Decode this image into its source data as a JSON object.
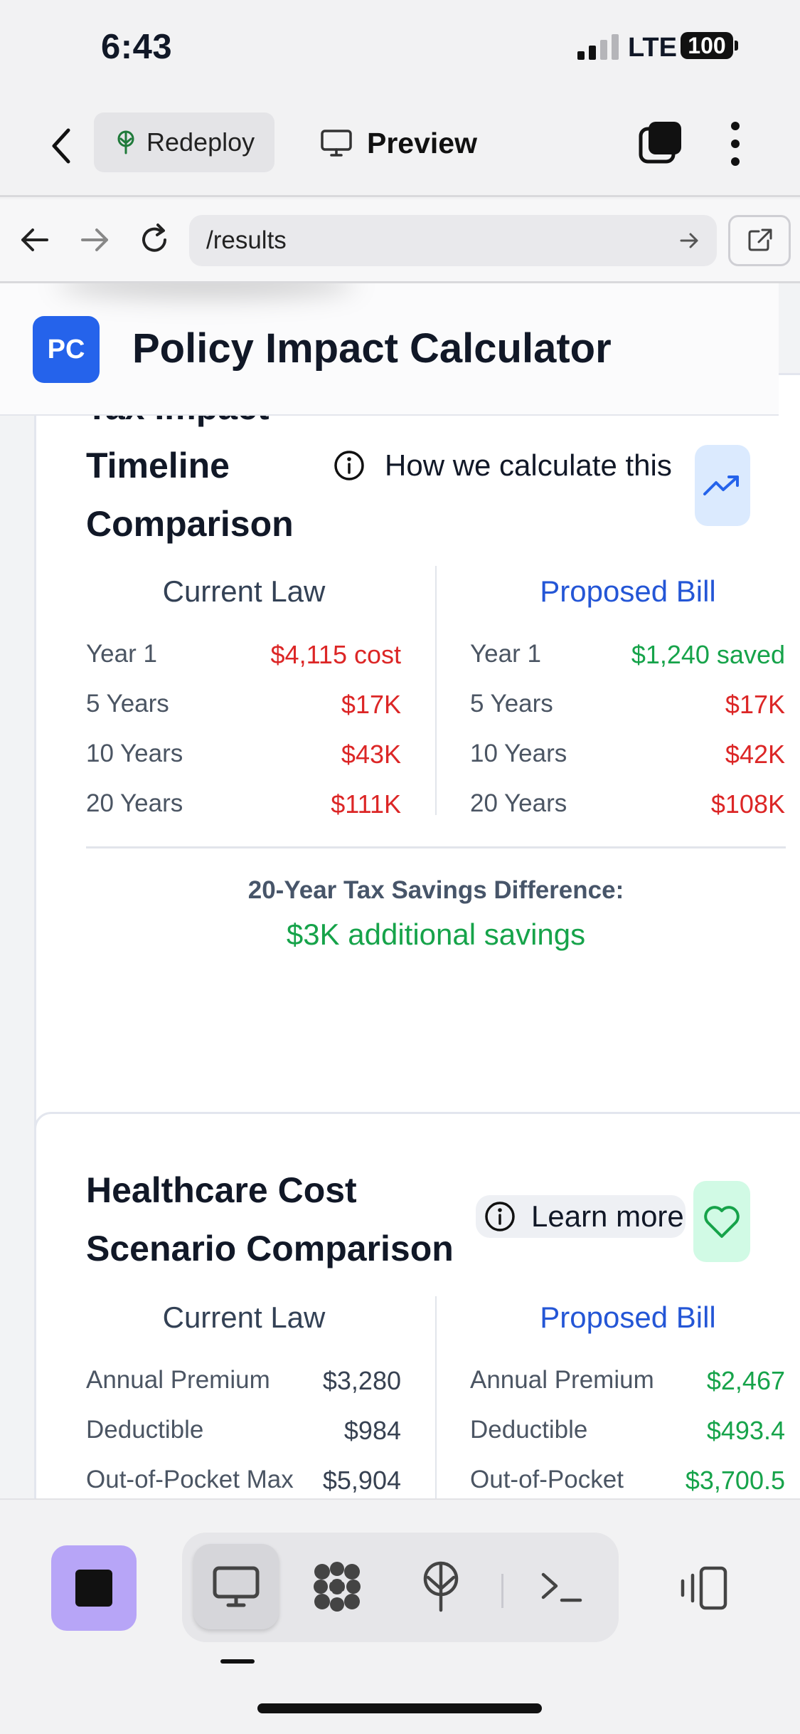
{
  "status": {
    "time": "6:43",
    "network": "LTE",
    "battery": "100"
  },
  "toolbar": {
    "redeploy_label": "Redeploy",
    "preview_label": "Preview"
  },
  "browser": {
    "url": "/results"
  },
  "app": {
    "logo": "PC",
    "title": "Policy Impact Calculator"
  },
  "tax_card": {
    "title_lines": [
      "Tax Impact",
      "Timeline",
      "Comparison"
    ],
    "info_label": "How we calculate this",
    "icon": "trending-up-icon",
    "current": {
      "heading": "Current Law",
      "rows": [
        {
          "label": "Year 1",
          "value": "$4,115 cost"
        },
        {
          "label": "5 Years",
          "value": "$17K"
        },
        {
          "label": "10 Years",
          "value": "$43K"
        },
        {
          "label": "20 Years",
          "value": "$111K"
        }
      ]
    },
    "proposed": {
      "heading": "Proposed Bill",
      "rows": [
        {
          "label": "Year 1",
          "value": "$1,240 saved"
        },
        {
          "label": "5 Years",
          "value": "$17K"
        },
        {
          "label": "10 Years",
          "value": "$42K"
        },
        {
          "label": "20 Years",
          "value": "$108K"
        }
      ]
    },
    "summary_label": "20-Year Tax Savings Difference:",
    "summary_value": "$3K additional savings"
  },
  "health_card": {
    "title_lines": [
      "Healthcare Cost",
      "Scenario Comparison"
    ],
    "info_label": "Learn more",
    "icon": "heart-icon",
    "current": {
      "heading": "Current Law",
      "rows": [
        {
          "label": "Annual Premium",
          "value": "$3,280"
        },
        {
          "label": "Deductible",
          "value": "$984"
        },
        {
          "label": "Out-of-Pocket Max",
          "value": "$5,904"
        }
      ]
    },
    "proposed": {
      "heading": "Proposed Bill",
      "rows": [
        {
          "label": "Annual Premium",
          "value": "$2,467"
        },
        {
          "label": "Deductible",
          "value": "$493.4"
        },
        {
          "label": "Out-of-Pocket",
          "value": "$3,700.5"
        }
      ]
    }
  },
  "colors": {
    "accent": "#2563eb",
    "negative": "#dc2626",
    "positive": "#16a34a",
    "stop_button": "#b7a5f7"
  }
}
